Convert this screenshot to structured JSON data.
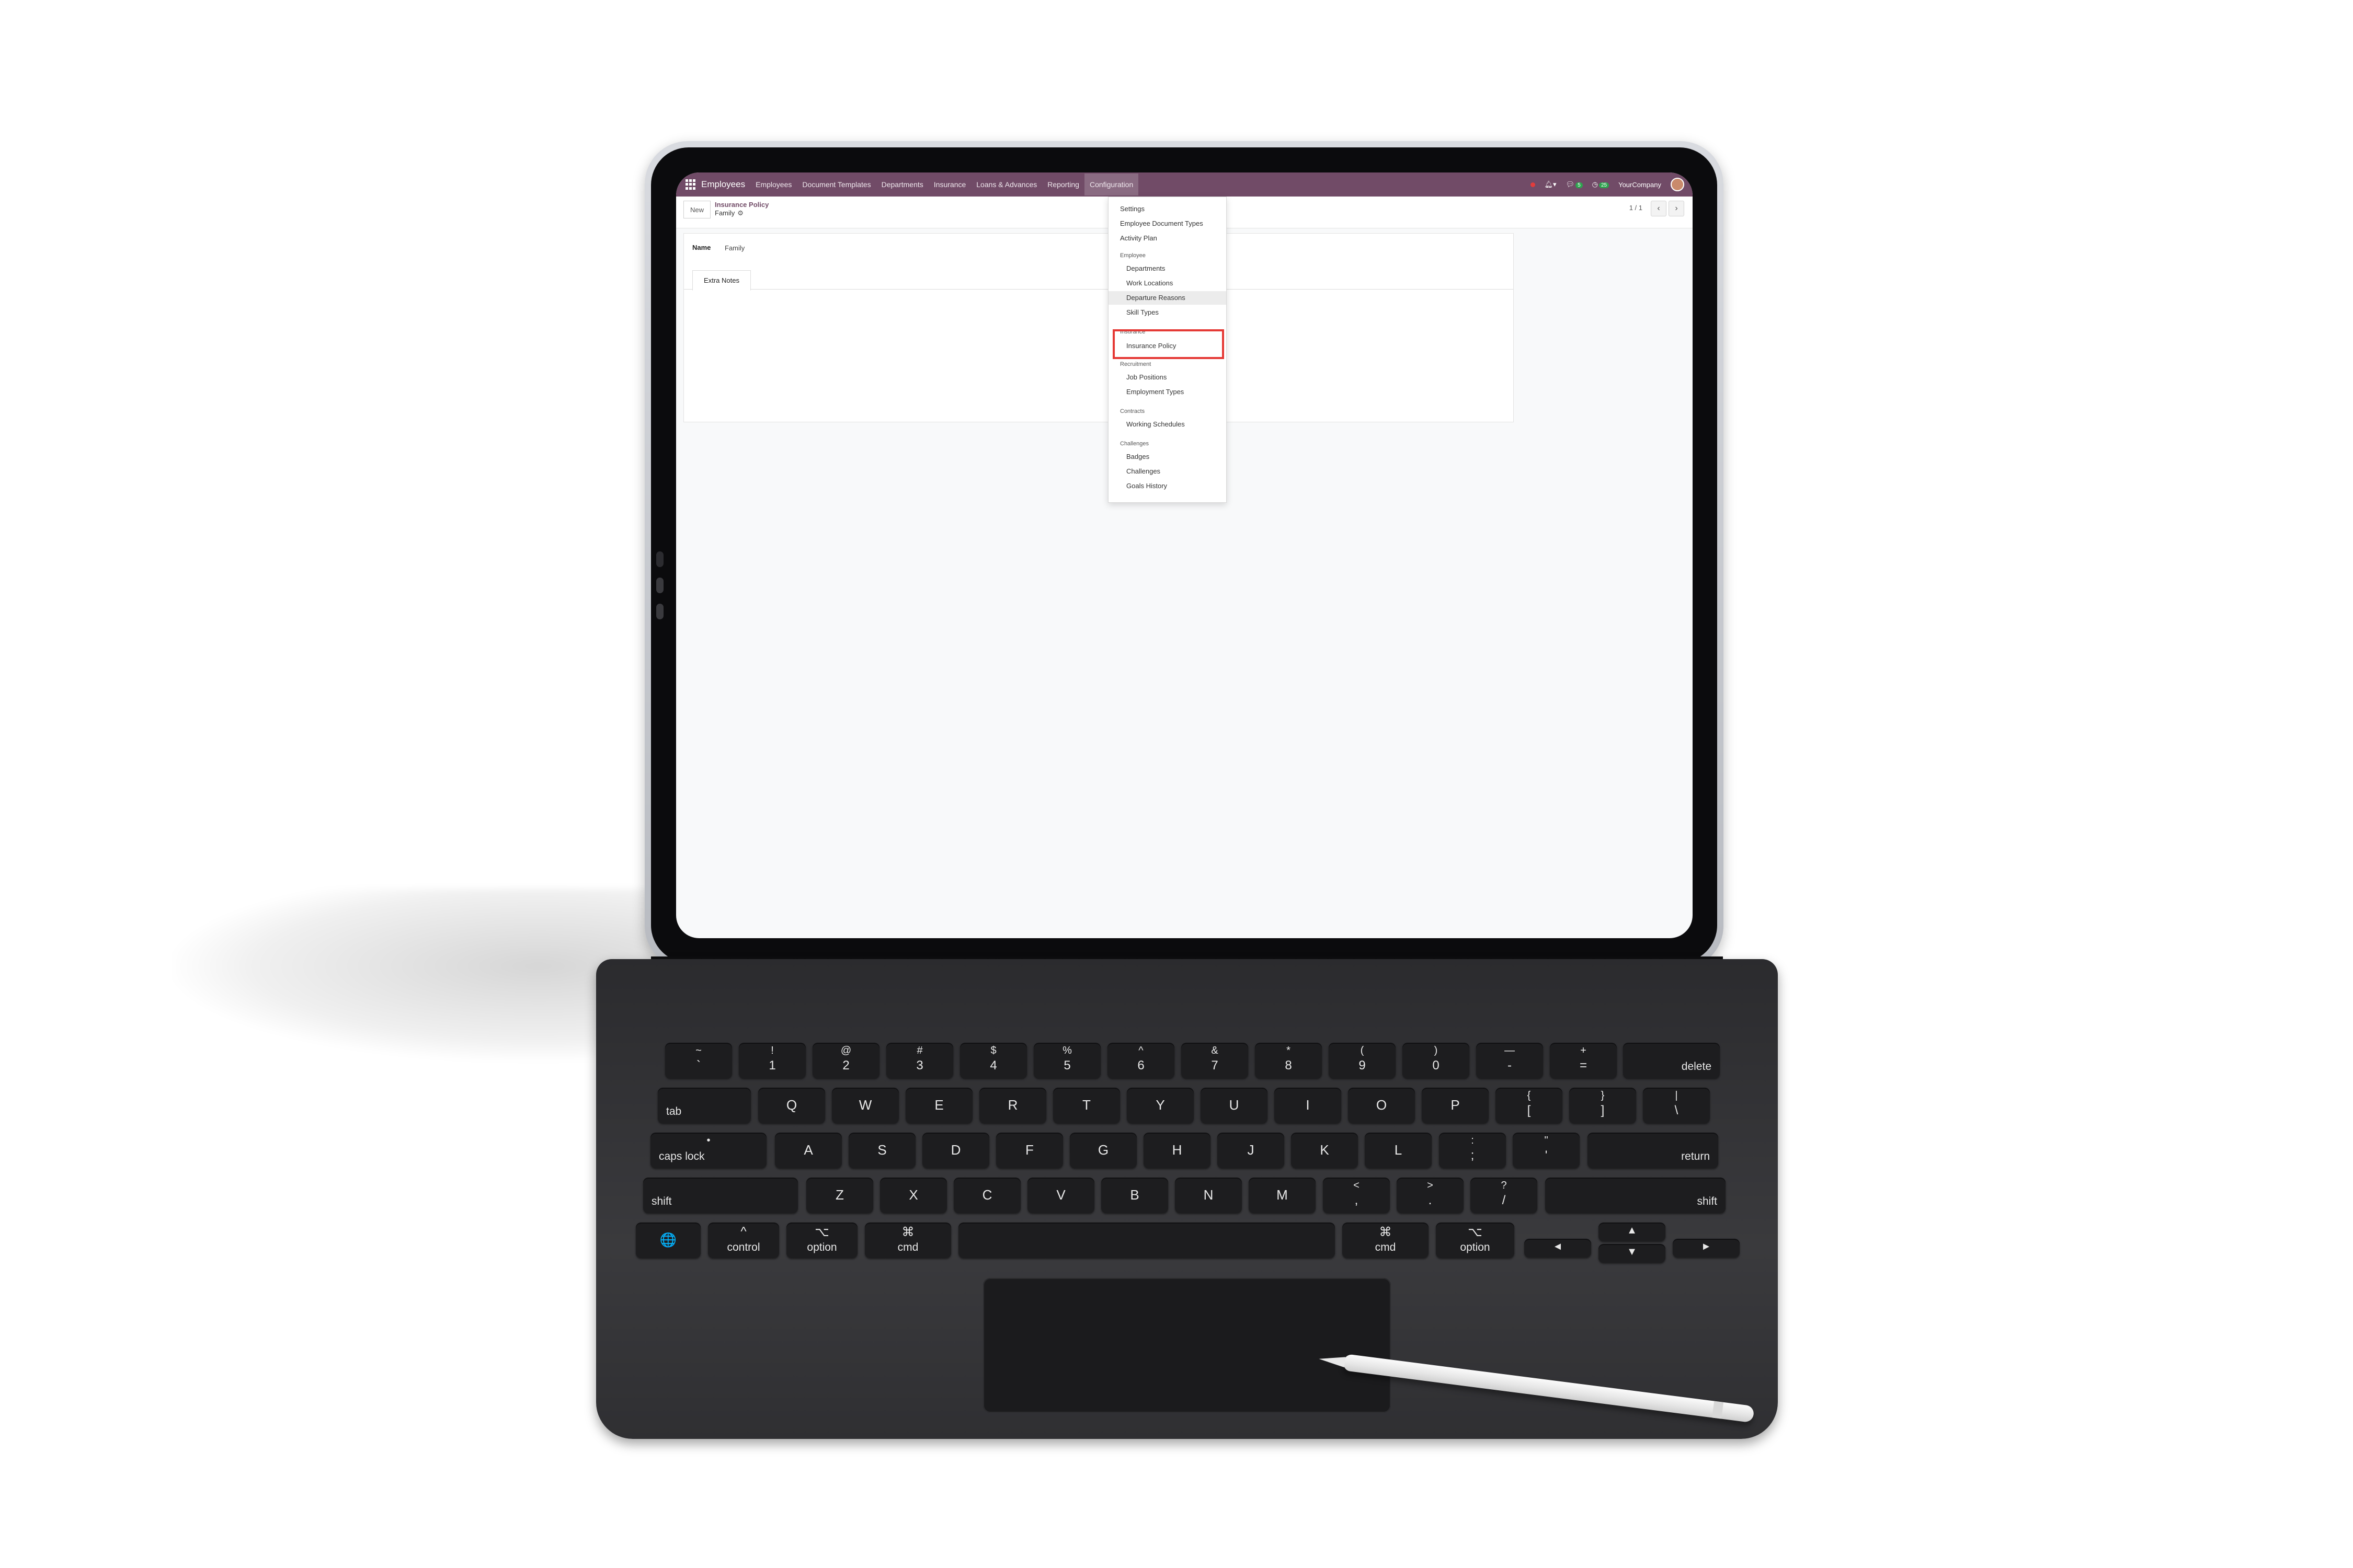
{
  "navbar": {
    "brand": "Employees",
    "menu": [
      "Employees",
      "Document Templates",
      "Departments",
      "Insurance",
      "Loans & Advances",
      "Reporting",
      "Configuration"
    ],
    "active_menu": "Configuration",
    "company": "YourCompany",
    "messages_badge": "5",
    "activities_badge": "25"
  },
  "control_panel": {
    "new_button": "New",
    "breadcrumb_parent": "Insurance Policy",
    "breadcrumb_current": "Family",
    "pager": "1 / 1"
  },
  "form": {
    "name_label": "Name",
    "name_value": "Family",
    "tab_label": "Extra Notes"
  },
  "dropdown": {
    "top_items": [
      "Settings",
      "Employee Document Types",
      "Activity Plan"
    ],
    "sections": [
      {
        "header": "Employee",
        "items": [
          "Departments",
          "Work Locations",
          "Departure Reasons",
          "Skill Types"
        ]
      },
      {
        "header": "Insurance",
        "items": [
          "Insurance Policy"
        ]
      },
      {
        "header": "Recruitment",
        "items": [
          "Job Positions",
          "Employment Types"
        ]
      },
      {
        "header": "Contracts",
        "items": [
          "Working Schedules"
        ]
      },
      {
        "header": "Challenges",
        "items": [
          "Badges",
          "Challenges",
          "Goals History"
        ]
      }
    ],
    "hovered_item": "Departure Reasons",
    "highlighted_item": "Insurance Policy"
  },
  "keyboard": {
    "row1": [
      [
        "~",
        "`"
      ],
      [
        "!",
        "1"
      ],
      [
        "@",
        "2"
      ],
      [
        "#",
        "3"
      ],
      [
        "$",
        "4"
      ],
      [
        "%",
        "5"
      ],
      [
        "^",
        "6"
      ],
      [
        "&",
        "7"
      ],
      [
        "*",
        "8"
      ],
      [
        "(",
        "9"
      ],
      [
        ")",
        "0"
      ],
      [
        "—",
        "-"
      ],
      [
        "+",
        "="
      ]
    ],
    "delete": "delete",
    "tab": "tab",
    "row2": [
      "Q",
      "W",
      "E",
      "R",
      "T",
      "Y",
      "U",
      "I",
      "O",
      "P"
    ],
    "row2_symbols": [
      [
        "{",
        "["
      ],
      [
        "}",
        "]"
      ],
      [
        "|",
        "\\"
      ]
    ],
    "caps": "caps lock",
    "row3": [
      "A",
      "S",
      "D",
      "F",
      "G",
      "H",
      "J",
      "K",
      "L"
    ],
    "row3_symbols": [
      [
        ":",
        ";"
      ],
      [
        "\"",
        "'"
      ]
    ],
    "return": "return",
    "shift": "shift",
    "row4": [
      "Z",
      "X",
      "C",
      "V",
      "B",
      "N",
      "M"
    ],
    "row4_symbols": [
      [
        "<",
        ","
      ],
      [
        ">",
        "."
      ],
      [
        "?",
        "/"
      ]
    ],
    "control": "control",
    "option": "option",
    "cmd": "cmd",
    "control_symbol": "^",
    "option_symbol": "⌥",
    "cmd_symbol": "⌘",
    "globe_symbol": "🌐",
    "arrows": {
      "left": "◄",
      "up": "▲",
      "down": "▼",
      "right": "►"
    }
  },
  "colors": {
    "navbar": "#714b67",
    "highlight_box": "#e53935",
    "keyboard": "#2b2b2e"
  }
}
